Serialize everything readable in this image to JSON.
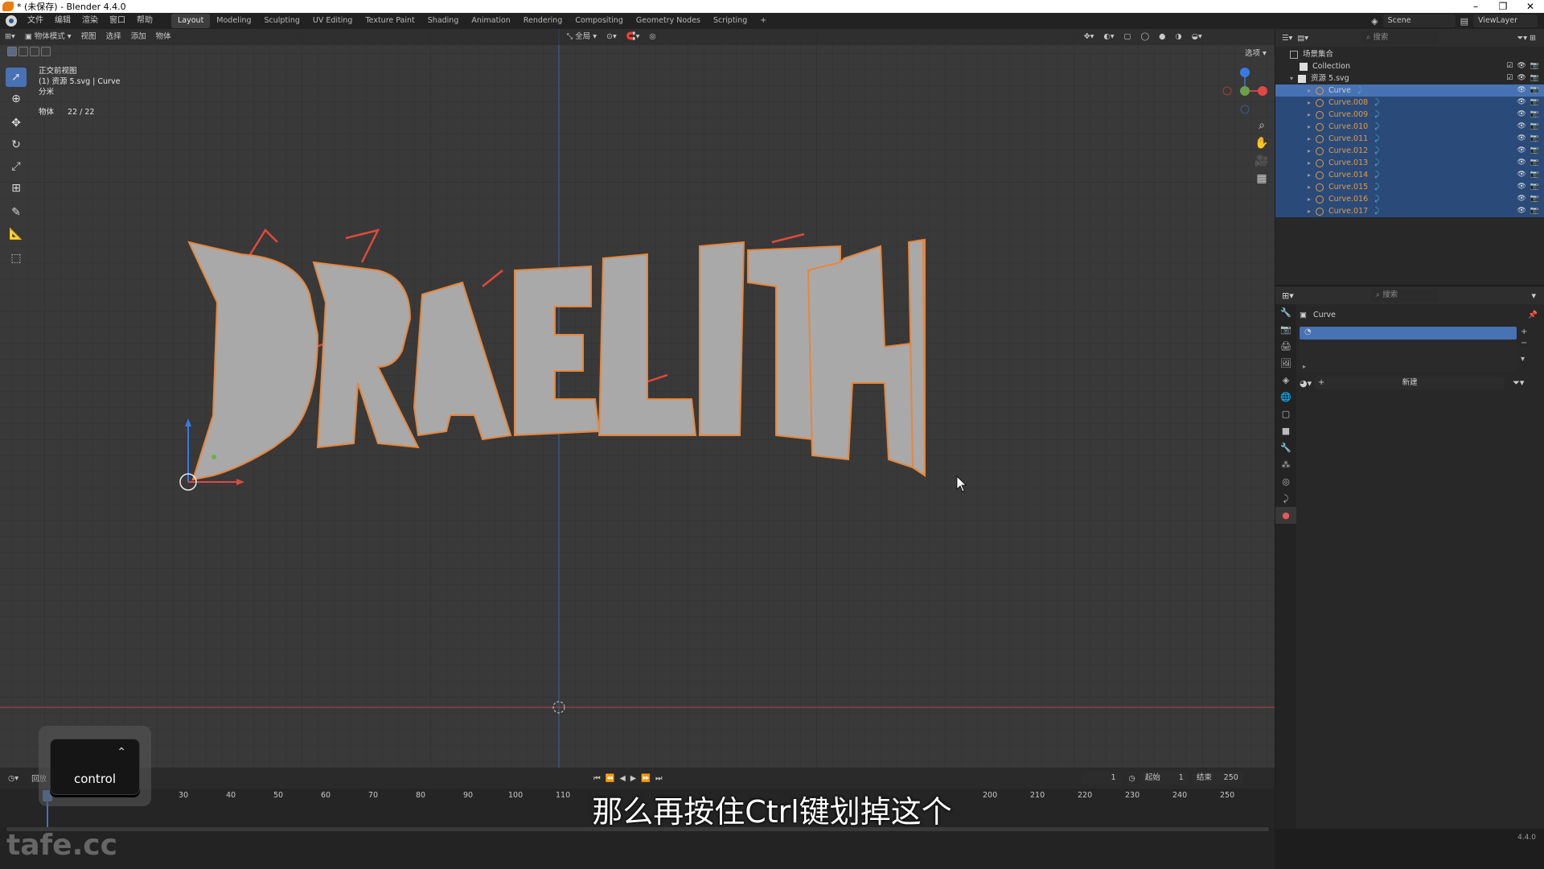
{
  "window": {
    "title": "* (未保存) - Blender 4.4.0"
  },
  "menubar": {
    "menus": [
      "文件",
      "编辑",
      "渲染",
      "窗口",
      "帮助"
    ],
    "workspaces": [
      "Layout",
      "Modeling",
      "Sculpting",
      "UV Editing",
      "Texture Paint",
      "Shading",
      "Animation",
      "Rendering",
      "Compositing",
      "Geometry Nodes",
      "Scripting"
    ],
    "active_workspace": "Layout",
    "scene": "Scene",
    "view_layer": "ViewLayer"
  },
  "viewport_header": {
    "mode": "物体模式",
    "menus": [
      "视图",
      "选择",
      "添加",
      "物体"
    ],
    "transform_orientation": "全局",
    "options_label": "选项"
  },
  "viewport_overlay": {
    "view_name": "正交前视图",
    "object_info": "(1) 资源 5.svg | Curve",
    "unit": "分米",
    "stat_label": "物体",
    "stat_value": "22 / 22"
  },
  "viewport": {
    "artwork_text": "DRAELITH",
    "accent_color": "#e8863a",
    "text_fill_color": "#a9a9a9",
    "x_axis_color": "#b04848",
    "y_axis_color": "#3a6aa8"
  },
  "outliner": {
    "search_placeholder": "搜索",
    "scene_collection": "场景集合",
    "rows": [
      {
        "name": "Collection",
        "level": 1,
        "kind": "collection"
      },
      {
        "name": "资源 5.svg",
        "level": 1,
        "kind": "collection"
      },
      {
        "name": "Curve",
        "level": 2,
        "kind": "curve",
        "active": true
      },
      {
        "name": "Curve.008",
        "level": 2,
        "kind": "curve"
      },
      {
        "name": "Curve.009",
        "level": 2,
        "kind": "curve"
      },
      {
        "name": "Curve.010",
        "level": 2,
        "kind": "curve"
      },
      {
        "name": "Curve.011",
        "level": 2,
        "kind": "curve"
      },
      {
        "name": "Curve.012",
        "level": 2,
        "kind": "curve"
      },
      {
        "name": "Curve.013",
        "level": 2,
        "kind": "curve"
      },
      {
        "name": "Curve.014",
        "level": 2,
        "kind": "curve"
      },
      {
        "name": "Curve.015",
        "level": 2,
        "kind": "curve"
      },
      {
        "name": "Curve.016",
        "level": 2,
        "kind": "curve"
      },
      {
        "name": "Curve.017",
        "level": 2,
        "kind": "curve"
      }
    ]
  },
  "properties": {
    "search_placeholder": "搜索",
    "object_name": "Curve",
    "new_button": "新建"
  },
  "timeline": {
    "playback_label": "回放",
    "current_frame": "1",
    "start_label": "起始",
    "start_value": "1",
    "end_label": "结束",
    "end_value": "250",
    "ticks": [
      "30",
      "40",
      "50",
      "60",
      "70",
      "80",
      "90",
      "100",
      "110",
      "200",
      "210",
      "220",
      "230",
      "240",
      "250"
    ]
  },
  "statusbar": {
    "version": "4.4.0"
  },
  "overlay": {
    "subtitle": "那么再按住Ctrl键划掉这个",
    "key_label": "control",
    "watermark": "tafe.cc"
  }
}
